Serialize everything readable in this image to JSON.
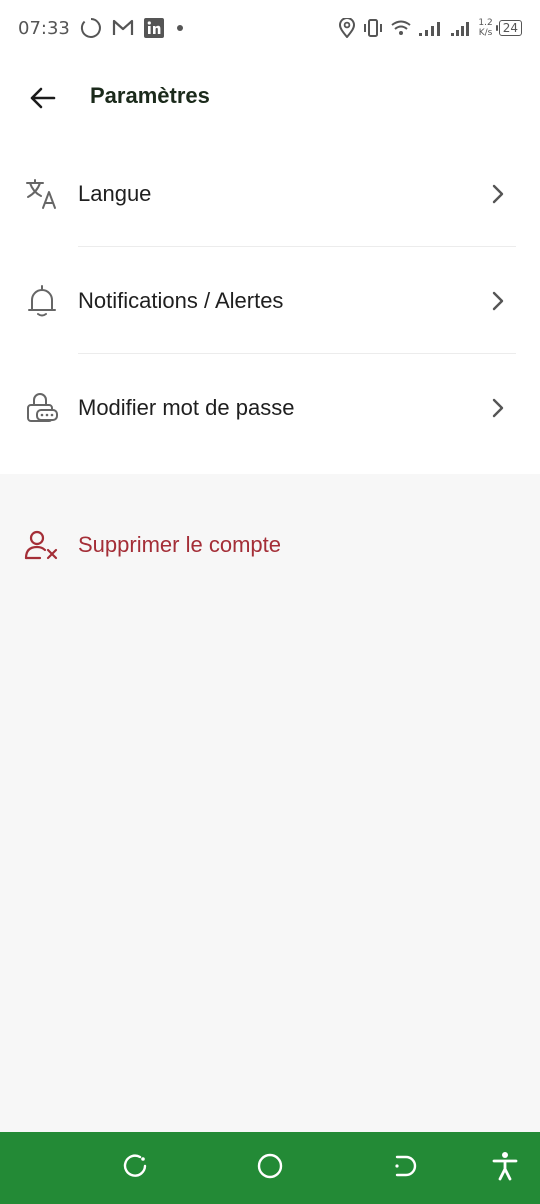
{
  "status_bar": {
    "time": "07:33",
    "net_speed_value": "1.2",
    "net_speed_unit": "K/s",
    "battery": "24",
    "icons": [
      "sync-icon",
      "gmail-icon",
      "linkedin-icon",
      "dot-icon",
      "location-icon",
      "vibrate-icon",
      "wifi-icon",
      "signal-icon",
      "signal-icon-2"
    ]
  },
  "header": {
    "title": "Paramètres",
    "back_icon": "arrow-left-icon"
  },
  "settings": {
    "items": [
      {
        "label": "Langue",
        "icon": "translate-icon"
      },
      {
        "label": "Notifications / Alertes",
        "icon": "bell-icon"
      },
      {
        "label": "Modifier mot de passe",
        "icon": "password-lock-icon"
      }
    ]
  },
  "danger": {
    "label": "Supprimer le compte",
    "icon": "user-remove-icon",
    "color": "#a42e37"
  },
  "nav": {
    "color": "#238a36",
    "buttons": [
      "recent-apps-icon",
      "home-icon",
      "back-icon",
      "accessibility-icon"
    ]
  }
}
